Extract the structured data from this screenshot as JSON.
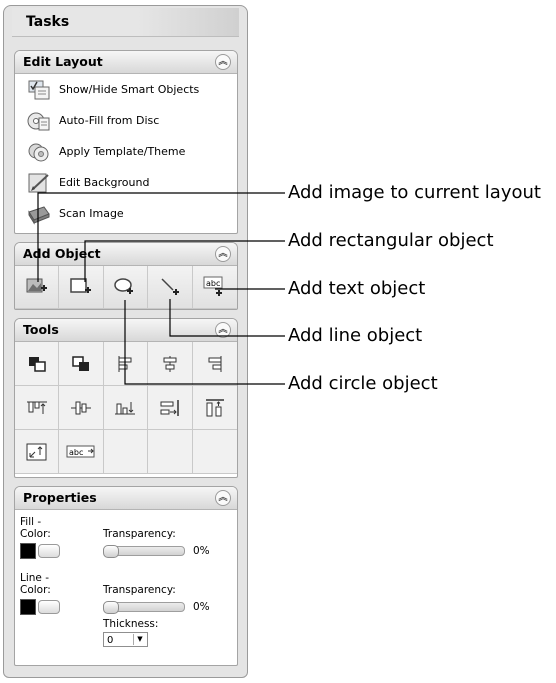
{
  "panel": {
    "title": "Tasks"
  },
  "edit_layout": {
    "title": "Edit Layout",
    "items": [
      {
        "label": "Show/Hide Smart Objects",
        "icon": "smart-objects-icon"
      },
      {
        "label": "Auto-Fill from Disc",
        "icon": "disc-autofill-icon"
      },
      {
        "label": "Apply Template/Theme",
        "icon": "template-theme-icon"
      },
      {
        "label": "Edit Background",
        "icon": "edit-background-icon"
      },
      {
        "label": "Scan Image",
        "icon": "scan-image-icon"
      }
    ]
  },
  "add_object": {
    "title": "Add Object",
    "buttons": [
      {
        "name": "add-image-button",
        "icon": "add-image-icon"
      },
      {
        "name": "add-rectangle-button",
        "icon": "add-rectangle-icon"
      },
      {
        "name": "add-circle-button",
        "icon": "add-circle-icon"
      },
      {
        "name": "add-line-button",
        "icon": "add-line-icon"
      },
      {
        "name": "add-text-button",
        "icon": "add-text-icon",
        "text": "abc"
      }
    ]
  },
  "tools": {
    "title": "Tools",
    "buttons": [
      "bring-to-front-icon",
      "send-to-back-icon",
      "align-left-icon",
      "align-center-icon",
      "align-right-icon",
      "align-top-icon",
      "align-middle-icon",
      "align-bottom-icon",
      "distribute-horizontal-icon",
      "distribute-vertical-icon",
      "resize-to-fit-icon",
      "text-fit-icon"
    ],
    "text_fit_label": "abc"
  },
  "properties": {
    "title": "Properties",
    "fill_label_1": "Fill -",
    "fill_label_2": "Color:",
    "fill_color": "#000000",
    "fill_transparency_label": "Transparency:",
    "fill_transparency_value": "0%",
    "fill_transparency_level": 0,
    "line_label_1": "Line -",
    "line_label_2": "Color:",
    "line_color": "#000000",
    "line_transparency_label": "Transparency:",
    "line_transparency_value": "0%",
    "line_transparency_level": 0,
    "thickness_label": "Thickness:",
    "thickness_value": "0"
  },
  "callouts": {
    "add_image": "Add image to current layout",
    "add_rectangle": "Add rectangular object",
    "add_text": "Add text object",
    "add_line": "Add line object",
    "add_circle": "Add circle object"
  }
}
